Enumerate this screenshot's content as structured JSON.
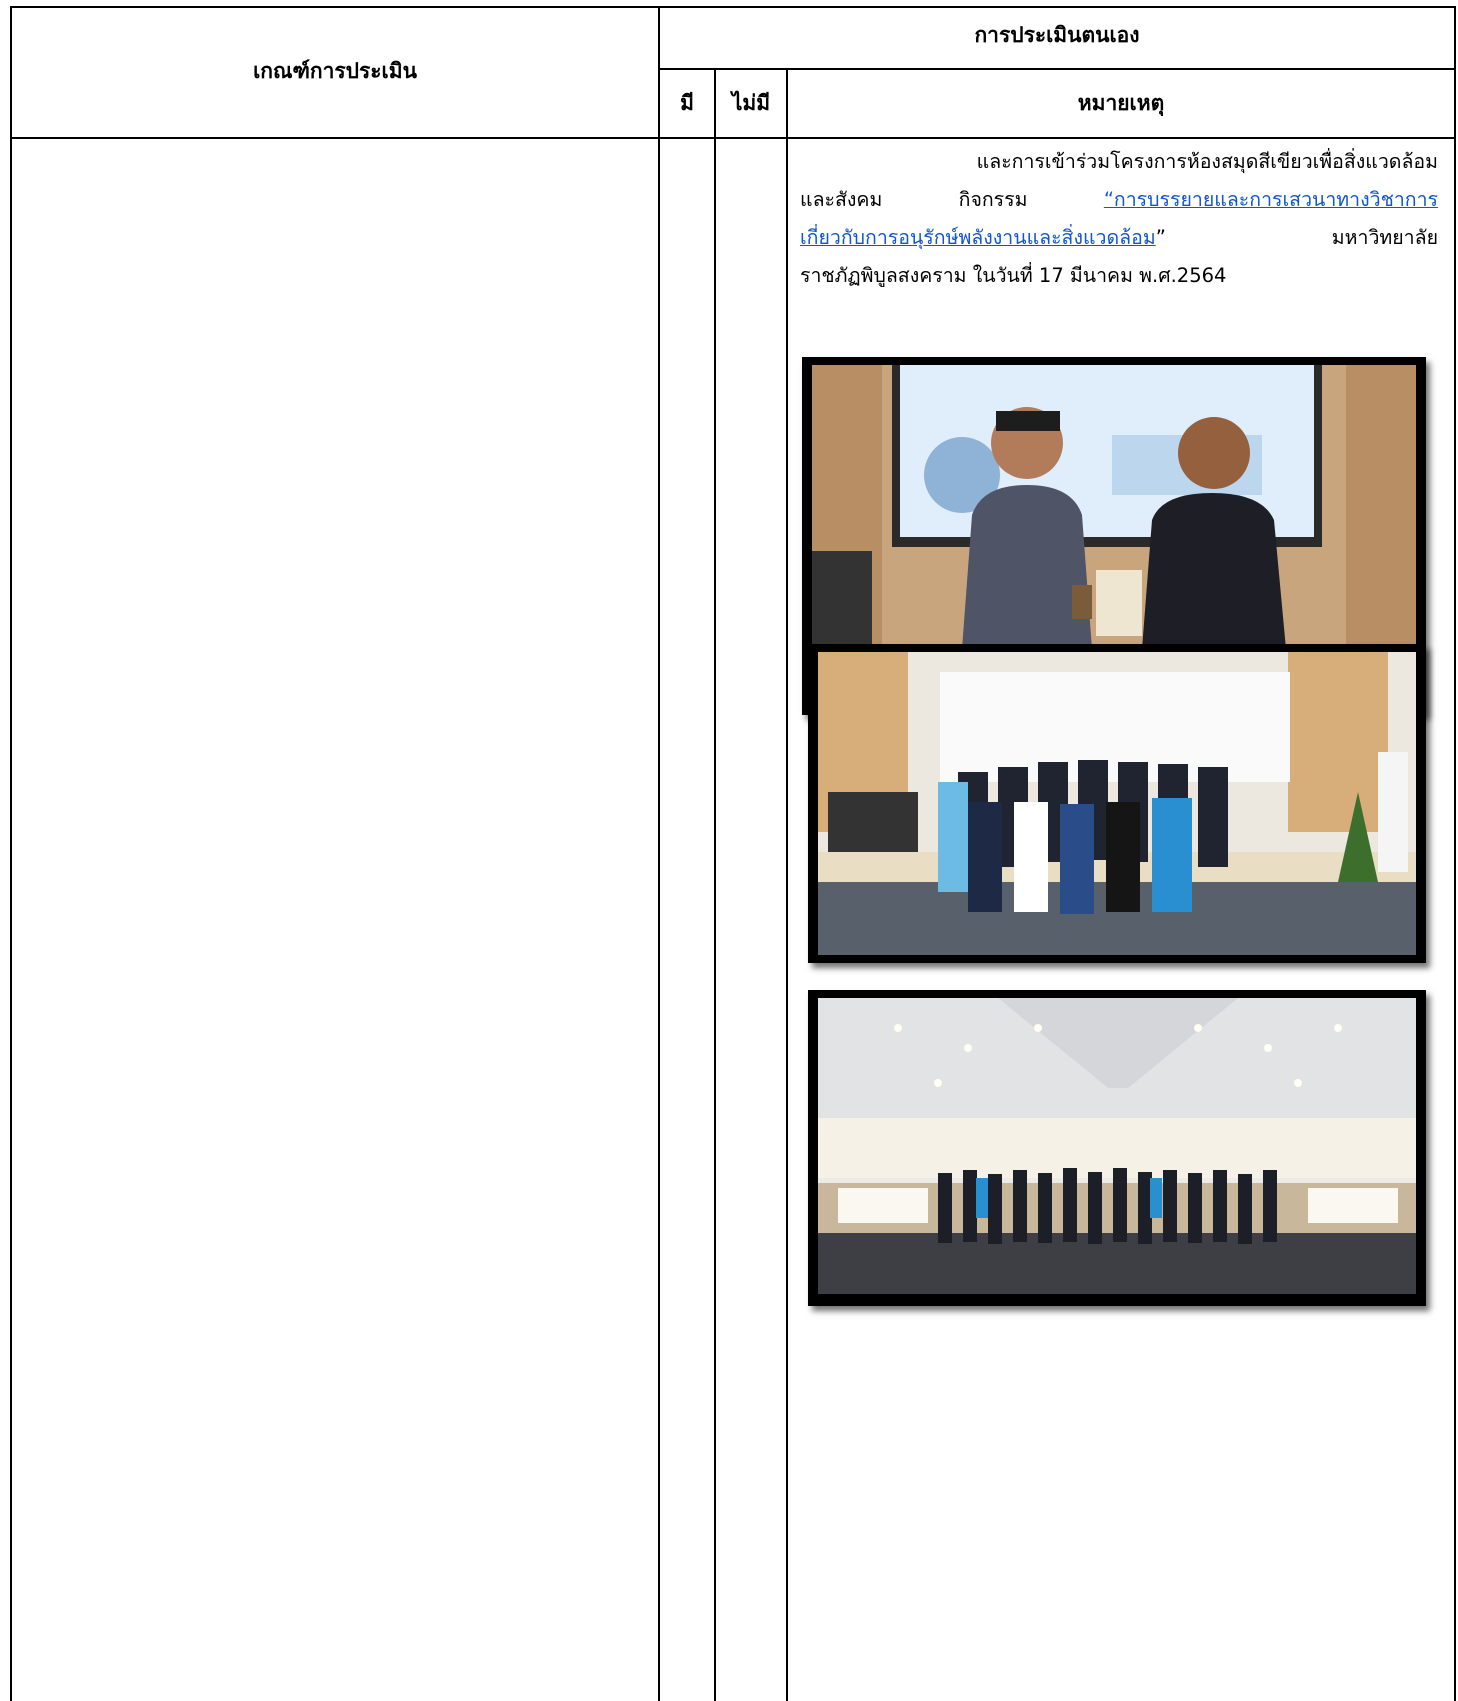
{
  "table": {
    "header": {
      "criteria": "เกณฑ์การประเมิน",
      "self_assessment": "การประเมินตนเอง",
      "have": "มี",
      "not_have": "ไม่มี",
      "remark": "หมายเหตุ"
    }
  },
  "remark": {
    "line1": "และการเข้าร่วมโครงการห้องสมุดสีเขียวเพื่อสิ่งแวดล้อม",
    "line2_prefix": "และสังคม กิจกรรม ",
    "link_part1": "“การบรรยายและการเสวนาทางวิชาการ",
    "link_part2": "เกี่ยวกับการอนุรักษ์พลังงานและสิ่งแวดล้อม",
    "line3_suffix": "” มหาวิทยาลัย",
    "line4": "ราชภัฏพิบูลสงคราม ในวันที่ 17 มีนาคม พ.ศ.2564"
  },
  "photos": [
    {
      "icon": "award-presentation-photo"
    },
    {
      "icon": "group-photo-stage"
    },
    {
      "icon": "hall-audience-photo"
    }
  ],
  "colors": {
    "link": "#1155cc",
    "border": "#000000"
  }
}
